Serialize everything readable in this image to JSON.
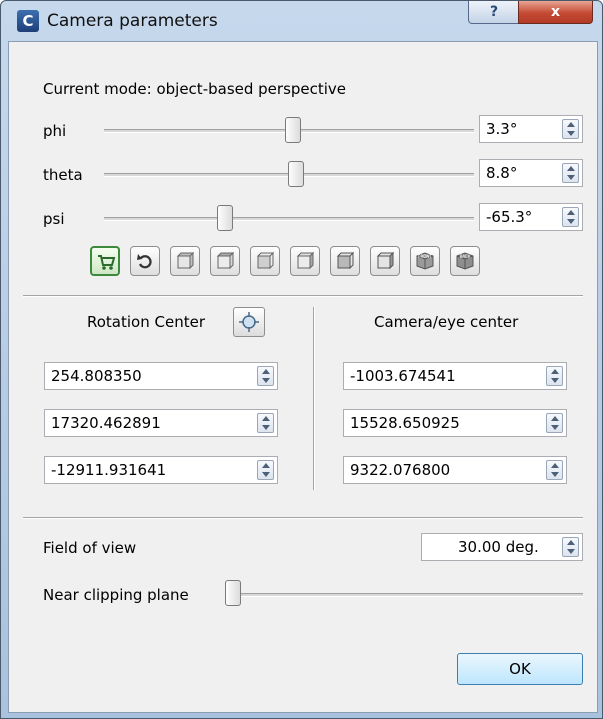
{
  "window": {
    "title": "Camera parameters",
    "app_icon_letter": "C",
    "help_label": "?",
    "close_label": "x"
  },
  "mode": {
    "text": "Current mode:  object-based perspective"
  },
  "angles": {
    "phi": {
      "label": "phi",
      "value": "3.3°",
      "slider_fraction": 0.51
    },
    "theta": {
      "label": "theta",
      "value": "8.8°",
      "slider_fraction": 0.52
    },
    "psi": {
      "label": "psi",
      "value": "-65.3°",
      "slider_fraction": 0.32
    }
  },
  "toolbar": {
    "buttons": [
      {
        "name": "link-icon"
      },
      {
        "name": "reset-icon"
      },
      {
        "name": "top-view-icon"
      },
      {
        "name": "bottom-view-icon"
      },
      {
        "name": "left-view-icon"
      },
      {
        "name": "right-view-icon"
      },
      {
        "name": "iso-view-1-icon"
      },
      {
        "name": "iso-view-2-icon"
      },
      {
        "name": "front-view-icon",
        "label": "FRONT"
      },
      {
        "name": "back-view-icon",
        "label": "BACK"
      }
    ]
  },
  "rotation_center": {
    "header": "Rotation Center",
    "values": [
      "254.808350",
      "17320.462891",
      "-12911.931641"
    ]
  },
  "camera_center": {
    "header": "Camera/eye center",
    "values": [
      "-1003.674541",
      "15528.650925",
      "9322.076800"
    ]
  },
  "fov": {
    "label": "Field of view",
    "value": "30.00 deg."
  },
  "near_clipping": {
    "label": "Near clipping plane",
    "slider_fraction": 0.0
  },
  "ok_label": "OK",
  "colors": {
    "title_bar": "#b9cee6",
    "close_button": "#c44a34",
    "ok_button": "#bee6fd"
  }
}
